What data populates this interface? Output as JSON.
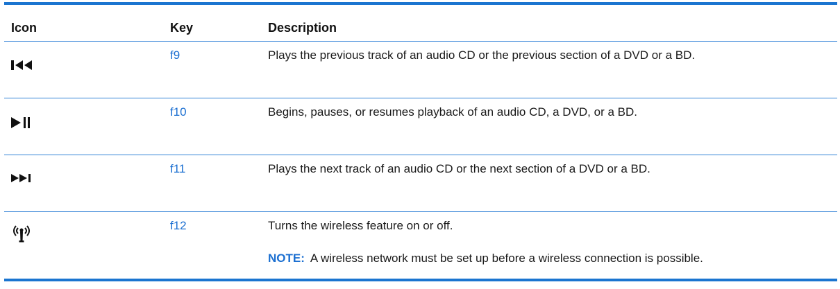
{
  "table": {
    "headers": {
      "icon": "Icon",
      "key": "Key",
      "description": "Description"
    },
    "rows": [
      {
        "icon": "previous-track-icon",
        "key": "f9",
        "description": "Plays the previous track of an audio CD or the previous section of a DVD or a BD."
      },
      {
        "icon": "play-pause-icon",
        "key": "f10",
        "description": "Begins, pauses, or resumes playback of an audio CD, a DVD, or a BD."
      },
      {
        "icon": "next-track-icon",
        "key": "f11",
        "description": "Plays the next track of an audio CD or the next section of a DVD or a BD."
      },
      {
        "icon": "wireless-icon",
        "key": "f12",
        "description": "Turns the wireless feature on or off.",
        "note_label": "NOTE:",
        "note_text": "A wireless network must be set up before a wireless connection is possible."
      }
    ]
  },
  "colors": {
    "rule": "#1b75d0",
    "link": "#1b6fd1",
    "text": "#1a1a1a"
  }
}
